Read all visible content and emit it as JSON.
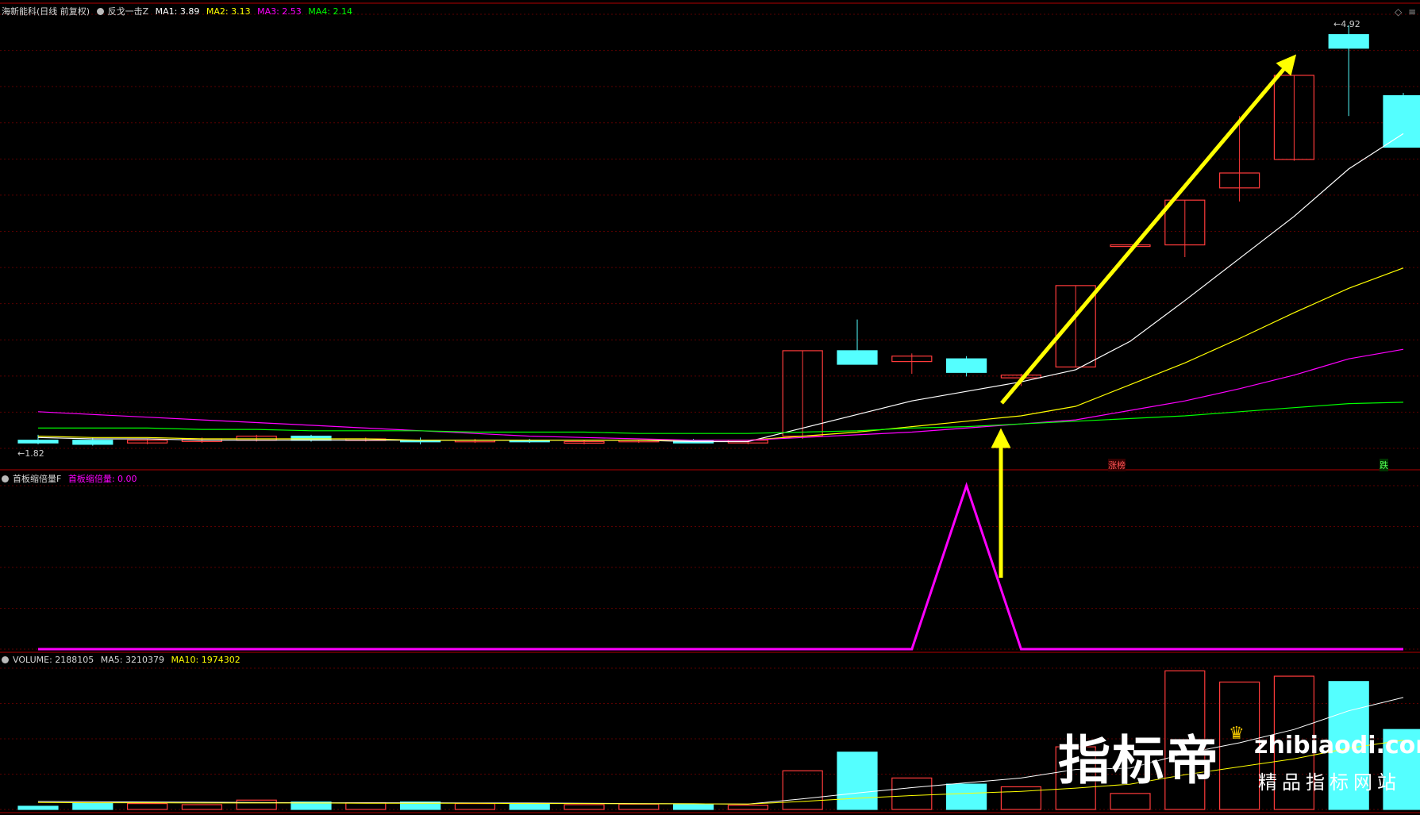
{
  "header": {
    "stock_name": "海新能科(日线 前复权)",
    "indicator_name": "反戈一击Z",
    "ma1_label": "MA1: 3.89",
    "ma2_label": "MA2: 3.13",
    "ma3_label": "MA3: 2.53",
    "ma4_label": "MA4: 2.14"
  },
  "price_panel": {
    "low_label": "1.82",
    "high_label": "4.92",
    "zt_tag": "涨榜",
    "die_tag": "跌"
  },
  "indicator_panel": {
    "title": "首板缩倍量F",
    "value_label": "首板缩倍量: 0.00"
  },
  "volume_panel": {
    "volume_label": "VOLUME: 2188105",
    "ma5_label": "MA5: 3210379",
    "ma10_label": "MA10: 1974302"
  },
  "watermark": {
    "main": "指标帝",
    "site": "zhibiaodi.com",
    "slogan": "精品指标网站"
  },
  "colors": {
    "up": "#ff3b3b",
    "down": "#54ffff",
    "ma1": "#ffffff",
    "ma2": "#ffff00",
    "ma3": "#ff00ff",
    "ma4": "#00ff00",
    "arrow": "#ffff00",
    "indicator": "#ff00ff"
  },
  "chart_data": {
    "type": "candlestick",
    "candles": [
      {
        "o": 1.86,
        "h": 1.9,
        "l": 1.83,
        "c": 1.84
      },
      {
        "o": 1.86,
        "h": 1.88,
        "l": 1.82,
        "c": 1.83
      },
      {
        "o": 1.84,
        "h": 1.87,
        "l": 1.83,
        "c": 1.86
      },
      {
        "o": 1.85,
        "h": 1.88,
        "l": 1.84,
        "c": 1.87
      },
      {
        "o": 1.86,
        "h": 1.9,
        "l": 1.85,
        "c": 1.89
      },
      {
        "o": 1.89,
        "h": 1.9,
        "l": 1.85,
        "c": 1.86
      },
      {
        "o": 1.87,
        "h": 1.88,
        "l": 1.85,
        "c": 1.87
      },
      {
        "o": 1.86,
        "h": 1.88,
        "l": 1.83,
        "c": 1.85
      },
      {
        "o": 1.85,
        "h": 1.87,
        "l": 1.84,
        "c": 1.86
      },
      {
        "o": 1.86,
        "h": 1.87,
        "l": 1.84,
        "c": 1.85
      },
      {
        "o": 1.84,
        "h": 1.86,
        "l": 1.83,
        "c": 1.85
      },
      {
        "o": 1.85,
        "h": 1.86,
        "l": 1.84,
        "c": 1.86
      },
      {
        "o": 1.86,
        "h": 1.87,
        "l": 1.84,
        "c": 1.84
      },
      {
        "o": 1.84,
        "h": 1.86,
        "l": 1.83,
        "c": 1.86
      },
      {
        "o": 1.89,
        "h": 2.52,
        "l": 1.87,
        "c": 2.52
      },
      {
        "o": 2.52,
        "h": 2.75,
        "l": 2.42,
        "c": 2.42
      },
      {
        "o": 2.44,
        "h": 2.5,
        "l": 2.35,
        "c": 2.48
      },
      {
        "o": 2.46,
        "h": 2.48,
        "l": 2.33,
        "c": 2.36
      },
      {
        "o": 2.32,
        "h": 2.35,
        "l": 2.26,
        "c": 2.34
      },
      {
        "o": 2.4,
        "h": 3.0,
        "l": 2.4,
        "c": 3.0
      },
      {
        "o": 3.3,
        "h": 3.3,
        "l": 3.3,
        "c": 3.3
      },
      {
        "o": 3.3,
        "h": 3.63,
        "l": 3.21,
        "c": 3.63
      },
      {
        "o": 3.72,
        "h": 4.25,
        "l": 3.62,
        "c": 3.83
      },
      {
        "o": 3.93,
        "h": 4.55,
        "l": 3.92,
        "c": 4.55
      },
      {
        "o": 4.85,
        "h": 4.92,
        "l": 4.25,
        "c": 4.75
      },
      {
        "o": 4.4,
        "h": 4.42,
        "l": 4.02,
        "c": 4.02
      }
    ],
    "ma1": [
      1.88,
      1.87,
      1.87,
      1.86,
      1.86,
      1.86,
      1.86,
      1.86,
      1.86,
      1.86,
      1.86,
      1.86,
      1.85,
      1.85,
      1.95,
      2.05,
      2.15,
      2.22,
      2.29,
      2.38,
      2.59,
      2.89,
      3.2,
      3.51,
      3.86,
      4.12
    ],
    "ma2": [
      1.89,
      1.88,
      1.88,
      1.87,
      1.87,
      1.87,
      1.87,
      1.86,
      1.86,
      1.86,
      1.86,
      1.86,
      1.86,
      1.86,
      1.89,
      1.92,
      1.96,
      2.0,
      2.04,
      2.11,
      2.27,
      2.43,
      2.61,
      2.8,
      2.98,
      3.13
    ],
    "ma3": [
      2.07,
      2.05,
      2.03,
      2.01,
      1.99,
      1.97,
      1.95,
      1.93,
      1.91,
      1.89,
      1.88,
      1.87,
      1.86,
      1.86,
      1.88,
      1.9,
      1.92,
      1.95,
      1.98,
      2.01,
      2.08,
      2.15,
      2.24,
      2.34,
      2.46,
      2.53
    ],
    "ma4": [
      1.95,
      1.95,
      1.95,
      1.94,
      1.94,
      1.93,
      1.93,
      1.93,
      1.92,
      1.92,
      1.92,
      1.91,
      1.91,
      1.91,
      1.92,
      1.93,
      1.95,
      1.96,
      1.98,
      2.0,
      2.02,
      2.04,
      2.07,
      2.1,
      2.13,
      2.14
    ],
    "indicator": [
      0,
      0,
      0,
      0,
      0,
      0,
      0,
      0,
      0,
      0,
      0,
      0,
      0,
      0,
      0,
      0,
      0,
      1,
      0,
      0,
      0,
      0,
      0,
      0,
      0,
      0
    ],
    "volume": [
      0.12,
      0.22,
      0.22,
      0.18,
      0.35,
      0.28,
      0.25,
      0.28,
      0.22,
      0.22,
      0.18,
      0.2,
      0.18,
      0.16,
      1.45,
      2.15,
      1.18,
      0.95,
      0.85,
      2.35,
      0.6,
      5.2,
      4.78,
      5.0,
      4.8,
      3.0
    ],
    "vol_ma5": [
      0.3,
      0.29,
      0.28,
      0.27,
      0.26,
      0.25,
      0.25,
      0.25,
      0.24,
      0.24,
      0.23,
      0.22,
      0.21,
      0.2,
      0.4,
      0.62,
      0.82,
      1.0,
      1.18,
      1.5,
      1.55,
      2.1,
      2.5,
      3.0,
      3.7,
      4.2
    ],
    "vol_ma10": [
      0.26,
      0.25,
      0.25,
      0.24,
      0.24,
      0.24,
      0.23,
      0.23,
      0.23,
      0.22,
      0.22,
      0.21,
      0.21,
      0.2,
      0.3,
      0.42,
      0.52,
      0.6,
      0.68,
      0.8,
      0.95,
      1.3,
      1.6,
      1.9,
      2.3,
      2.6
    ]
  }
}
